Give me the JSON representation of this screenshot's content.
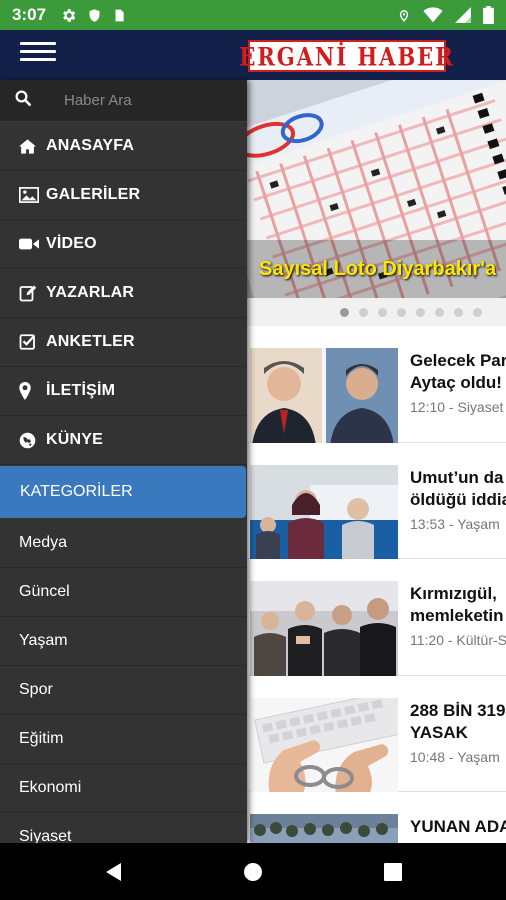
{
  "status_bar": {
    "time": "3:07",
    "left_icons": [
      "gear-icon",
      "shield-icon",
      "sim-card-icon"
    ],
    "right_icons": [
      "location-icon",
      "wifi-icon",
      "signal-icon",
      "battery-icon"
    ]
  },
  "app": {
    "logo_text": "ERGANİ HABER",
    "brand_color": "#d31d1d",
    "header_color": "#13204a"
  },
  "drawer": {
    "search_placeholder": "Haber Ara",
    "menu_items": [
      {
        "label": "ANASAYFA",
        "icon": "home-icon"
      },
      {
        "label": "GALERİLER",
        "icon": "image-icon"
      },
      {
        "label": "VİDEO",
        "icon": "video-camera-icon"
      },
      {
        "label": "YAZARLAR",
        "icon": "edit-icon"
      },
      {
        "label": "ANKETLER",
        "icon": "check-square-icon"
      },
      {
        "label": "İLETİŞİM",
        "icon": "location-pin-icon"
      },
      {
        "label": "KÜNYE",
        "icon": "globe-icon"
      }
    ],
    "categories_header": "KATEGORİLER",
    "categories_color": "#3a79be",
    "categories": [
      "Medya",
      "Güncel",
      "Yaşam",
      "Spor",
      "Eğitim",
      "Ekonomi",
      "Siyaset"
    ]
  },
  "slider": {
    "caption": "Sayısal Loto Diyarbakır'a",
    "dot_count": 8,
    "active_dot": 1
  },
  "news": [
    {
      "title": "Gelecek Par\nAytaç oldu!",
      "meta": "12:10 - Siyaset"
    },
    {
      "title": "Umut’un da\nöldüğü iddia",
      "meta": "13:53 - Yaşam"
    },
    {
      "title": "Kırmızıgül, \nmemleketin",
      "meta": "11:20 - Kültür-S"
    },
    {
      "title": "288 BİN 319\nYASAK",
      "meta": "10:48 - Yaşam"
    },
    {
      "title": "YUNAN ADA",
      "meta": ""
    }
  ]
}
